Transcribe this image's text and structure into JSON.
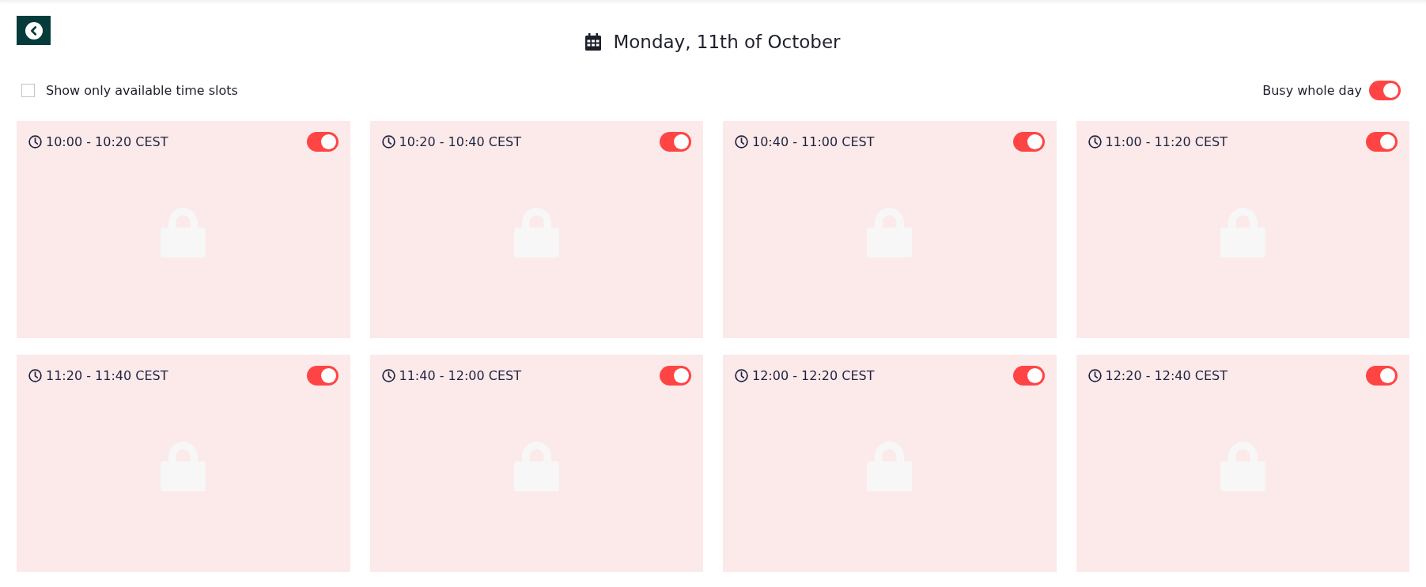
{
  "header": {
    "title": "Monday, 11th of October"
  },
  "filter": {
    "label": "Show only available time slots",
    "checked": false
  },
  "busy_whole_day": {
    "label": "Busy whole day",
    "on": true
  },
  "slots": [
    {
      "time": "10:00 - 10:20 CEST",
      "on": true
    },
    {
      "time": "10:20 - 10:40 CEST",
      "on": true
    },
    {
      "time": "10:40 - 11:00 CEST",
      "on": true
    },
    {
      "time": "11:00 - 11:20 CEST",
      "on": true
    },
    {
      "time": "11:20 - 11:40 CEST",
      "on": true
    },
    {
      "time": "11:40 - 12:00 CEST",
      "on": true
    },
    {
      "time": "12:00 - 12:20 CEST",
      "on": true
    },
    {
      "time": "12:20 - 12:40 CEST",
      "on": true
    }
  ]
}
